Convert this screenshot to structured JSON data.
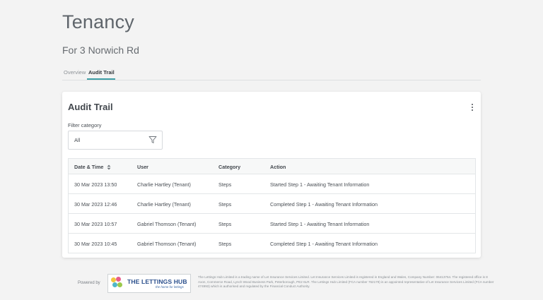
{
  "page": {
    "title": "Tenancy",
    "subtitle": "For 3 Norwich Rd"
  },
  "tabs": [
    {
      "label": "Overview"
    },
    {
      "label": "Audit Trail"
    }
  ],
  "card": {
    "title": "Audit Trail",
    "menu_icon": "kebab-menu-icon",
    "filter": {
      "label": "Filter category",
      "value": "All",
      "icon": "filter-funnel-icon"
    }
  },
  "table": {
    "headers": [
      "Date & Time",
      "User",
      "Category",
      "Action"
    ],
    "sort_icon": "sort-updown-icon",
    "rows": [
      [
        "30 Mar 2023 13:50",
        "Charlie Hartley (Tenant)",
        "Steps",
        "Started Step 1 - Awaiting Tenant Information"
      ],
      [
        "30 Mar 2023 12:46",
        "Charlie Hartley (Tenant)",
        "Steps",
        "Completed Step 1 - Awaiting Tenant Information"
      ],
      [
        "30 Mar 2023 10:57",
        "Gabriel Thomson (Tenant)",
        "Steps",
        "Started Step 1 - Awaiting Tenant Information"
      ],
      [
        "30 Mar 2023 10:45",
        "Gabriel Thomson (Tenant)",
        "Steps",
        "Completed Step 1 - Awaiting Tenant Information"
      ]
    ]
  },
  "footer": {
    "powered_by": "Powered by",
    "logo_text": "THE LETTINGS HUB",
    "logo_tagline": "the home for lettings",
    "legal": "The Lettings Hub Limited is a trading name of Let Insurance Services Limited. Let Insurance Services Limited is registered in England and Wales, Company Number: 06413754. The registered office is 8 Axon, Commerce Road, Lynch Wood Business Park, Peterborough, PE2 6LR. The Lettings Hub Limited (FCA number 762179) is an appointed representative of Let Insurance Services Limited (FCA number 474993) which is authorised and regulated by the Financial Conduct Authority."
  },
  "colors": {
    "accent": "#3f9fa6",
    "logo_blue": "#2a4f8c",
    "background": "#f3f3f3"
  }
}
